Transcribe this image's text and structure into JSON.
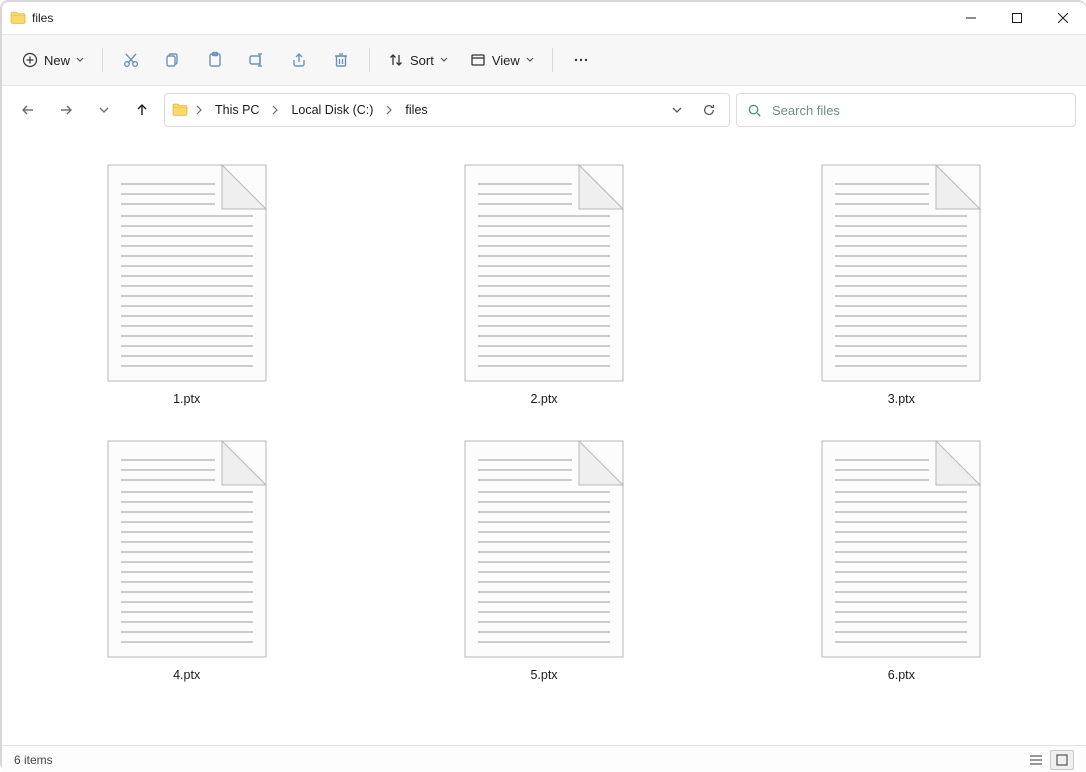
{
  "window": {
    "title": "files"
  },
  "toolbar": {
    "new_label": "New",
    "sort_label": "Sort",
    "view_label": "View"
  },
  "breadcrumbs": [
    "This PC",
    "Local Disk (C:)",
    "files"
  ],
  "search": {
    "placeholder": "Search files"
  },
  "files": [
    {
      "name": "1.ptx"
    },
    {
      "name": "2.ptx"
    },
    {
      "name": "3.ptx"
    },
    {
      "name": "4.ptx"
    },
    {
      "name": "5.ptx"
    },
    {
      "name": "6.ptx"
    }
  ],
  "status": {
    "text": "6 items"
  }
}
